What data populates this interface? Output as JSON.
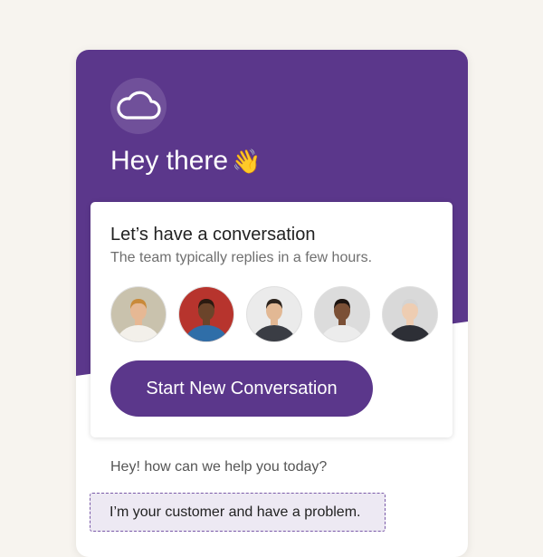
{
  "theme": {
    "brand_color": "#5b378b",
    "button_color": "#5b378b",
    "input_bg": "#ede9f3",
    "input_border": "#7a5aa8"
  },
  "header": {
    "logo_icon": "cloud-icon",
    "greeting": "Hey there",
    "greeting_emoji": "👋"
  },
  "card": {
    "title": "Let’s have a conversation",
    "subtitle": "The team typically replies in a few hours.",
    "avatars": [
      {
        "name": "team-avatar-1",
        "skin": "#e6b894",
        "hair": "#c98a3a",
        "shirt": "#f3f0ea",
        "bg": "#c9c2ad"
      },
      {
        "name": "team-avatar-2",
        "skin": "#6b442a",
        "hair": "#2b1a10",
        "shirt": "#2f6ea8",
        "bg": "#b7342d"
      },
      {
        "name": "team-avatar-3",
        "skin": "#e2b894",
        "hair": "#2d241d",
        "shirt": "#3a3d44",
        "bg": "#ebebeb"
      },
      {
        "name": "team-avatar-4",
        "skin": "#7b5036",
        "hair": "#1d1410",
        "shirt": "#ececec",
        "bg": "#dcdcdc"
      },
      {
        "name": "team-avatar-5",
        "skin": "#eecdb2",
        "hair": "#d4d4d4",
        "shirt": "#2d2f36",
        "bg": "#d9d9d9"
      }
    ],
    "button_label": "Start New Conversation"
  },
  "chat": {
    "prompt": "Hey! how can we help you today?",
    "reply_value": "I’m your customer and have a problem."
  }
}
